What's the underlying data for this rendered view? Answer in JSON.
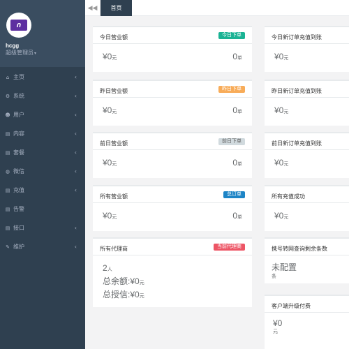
{
  "tabs": {
    "home": "首页"
  },
  "profile": {
    "logo_text": "ᑎ",
    "name": "hcgg",
    "role": "超级管理员"
  },
  "menu": [
    {
      "label": "主页",
      "icon": "home-icon",
      "glyph": "⌂",
      "arrow": "‹"
    },
    {
      "label": "系统",
      "icon": "gears-icon",
      "glyph": "⚙",
      "arrow": "‹"
    },
    {
      "label": "用户",
      "icon": "users-icon",
      "glyph": "☻",
      "arrow": "‹"
    },
    {
      "label": "内容",
      "icon": "file-icon",
      "glyph": "▤",
      "arrow": "‹"
    },
    {
      "label": "套餐",
      "icon": "file-text-icon",
      "glyph": "▤",
      "arrow": "‹"
    },
    {
      "label": "微信",
      "icon": "wechat-icon",
      "glyph": "◍",
      "arrow": "‹"
    },
    {
      "label": "充值",
      "icon": "file-text-icon",
      "glyph": "▤",
      "arrow": "‹"
    },
    {
      "label": "告警",
      "icon": "file-text-icon",
      "glyph": "▤",
      "arrow": ""
    },
    {
      "label": "接口",
      "icon": "file-icon",
      "glyph": "▤",
      "arrow": "‹"
    },
    {
      "label": "维护",
      "icon": "wrench-icon",
      "glyph": "✎",
      "arrow": "‹"
    }
  ],
  "cards": {
    "today": {
      "title": "今日营业额",
      "badge": "今日下单",
      "badge_color": "#1ab394",
      "money": "¥0",
      "money_unit": "元",
      "count": "0",
      "count_unit": "单"
    },
    "yesterday": {
      "title": "昨日营业额",
      "badge": "昨日下单",
      "badge_color": "#f8ac59",
      "money": "¥0",
      "money_unit": "元",
      "count": "0",
      "count_unit": "单"
    },
    "before": {
      "title": "前日营业额",
      "badge": "前日下单",
      "badge_color": "#d1dade",
      "money": "¥0",
      "money_unit": "元",
      "count": "0",
      "count_unit": "单"
    },
    "all": {
      "title": "所有营业额",
      "badge": "总订单",
      "badge_color": "#1c84c6",
      "money": "¥0",
      "money_unit": "元",
      "count": "0",
      "count_unit": "单"
    },
    "agents": {
      "title": "所有代理商",
      "badge": "当前代理商",
      "badge_color": "#ed5565",
      "count": "2",
      "count_unit": "人",
      "balance_label": "总余额:",
      "balance": "¥0",
      "balance_unit": "元",
      "credit_label": "总授信:",
      "credit": "¥0",
      "credit_unit": "元"
    }
  },
  "right_cards": {
    "today_recharge": {
      "title": "今日新订单充值到账",
      "money": "¥0",
      "unit": "元"
    },
    "yesterday_recharge": {
      "title": "昨日新订单充值到账",
      "money": "¥0",
      "unit": "元"
    },
    "before_recharge": {
      "title": "前日新订单充值到账",
      "money": "¥0",
      "unit": "元"
    },
    "all_recharge": {
      "title": "所有充值成功",
      "money": "¥0",
      "unit": "元"
    },
    "query": {
      "title": "携号转网查询剩余条数",
      "value": "未配置",
      "unit": "条"
    },
    "upgrade": {
      "title": "客户端升级付费",
      "money": "¥0",
      "unit": "元"
    }
  }
}
